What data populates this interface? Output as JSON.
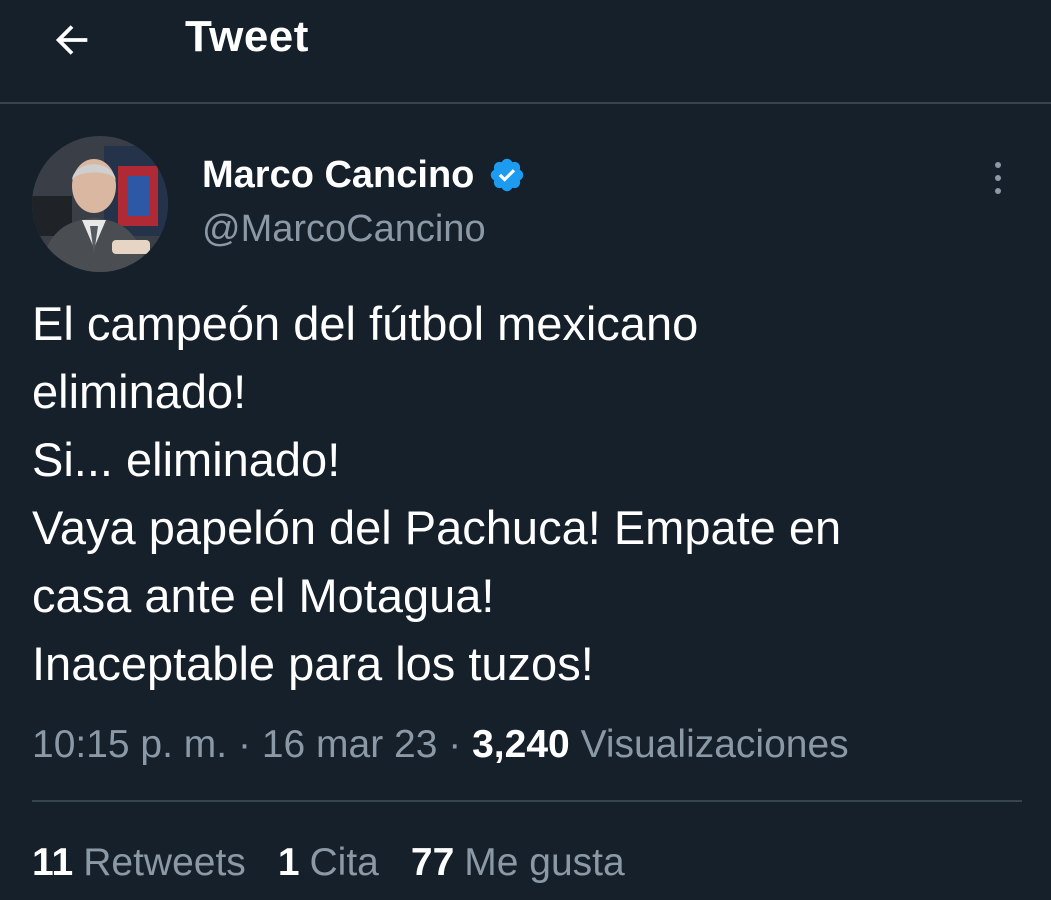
{
  "header": {
    "title": "Tweet",
    "back_icon": "arrow-left-icon"
  },
  "author": {
    "name": "Marco Cancino",
    "handle": "@MarcoCancino",
    "verified": true,
    "verified_color": "#1d9bf0"
  },
  "tweet": {
    "lines": [
      "El campeón del fútbol mexicano",
      "eliminado!",
      "Si... eliminado!",
      "Vaya papelón del Pachuca! Empate en",
      "casa ante el Motagua!",
      "Inaceptable para los tuzos!"
    ]
  },
  "meta": {
    "time": "10:15 p. m.",
    "separator": "·",
    "date": "16 mar 23",
    "views_count": "3,240",
    "views_label": "Visualizaciones"
  },
  "stats": {
    "retweets_count": "11",
    "retweets_label": "Retweets",
    "quotes_count": "1",
    "quotes_label": "Cita",
    "likes_count": "77",
    "likes_label": "Me gusta"
  },
  "colors": {
    "background": "#15202b",
    "text_primary": "#ffffff",
    "text_secondary": "#8b98a5",
    "divider": "#38444d",
    "accent": "#1d9bf0"
  }
}
